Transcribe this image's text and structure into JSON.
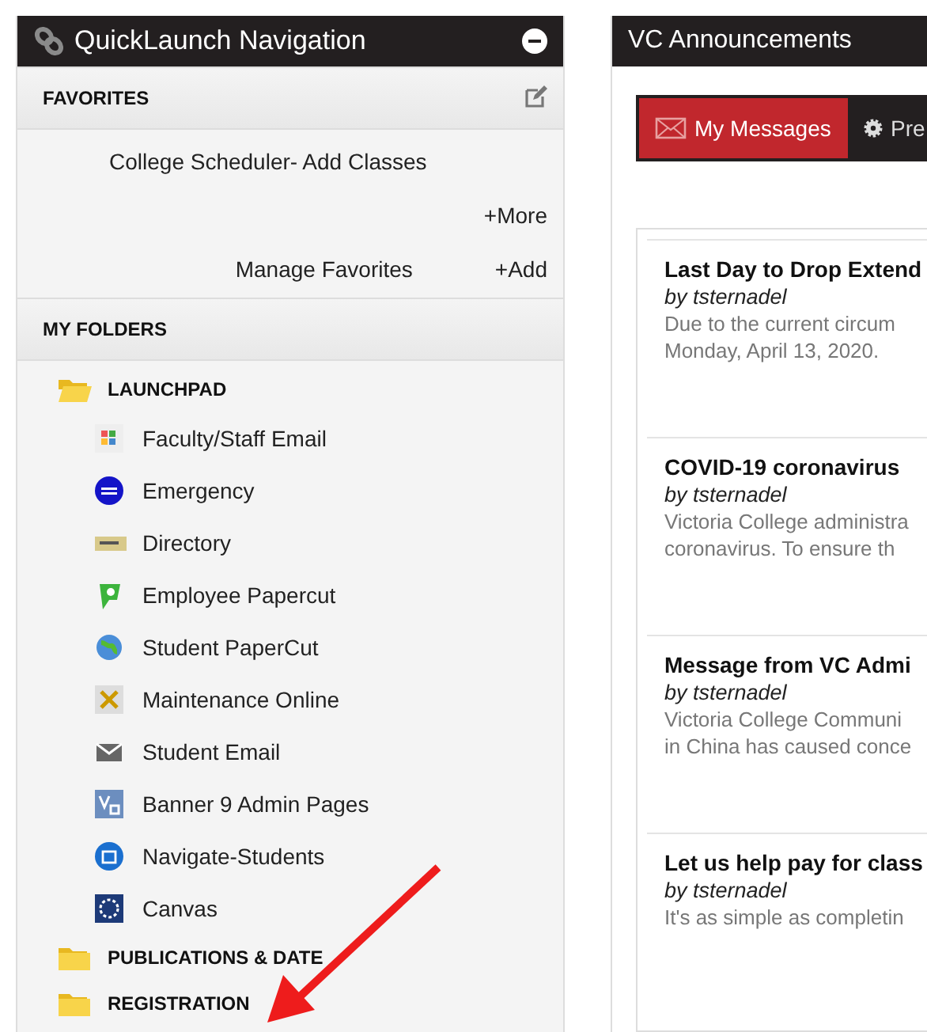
{
  "quicklaunch": {
    "title": "QuickLaunch Navigation",
    "collapsed": false,
    "favorites": {
      "heading": "FAVORITES",
      "items": [
        "College Scheduler- Add Classes"
      ],
      "more": "+More",
      "manage": "Manage Favorites",
      "add": "+Add"
    },
    "folders": {
      "heading": "MY FOLDERS",
      "items": [
        {
          "label": "LAUNCHPAD",
          "expanded": true,
          "children": [
            {
              "label": "Faculty/Staff Email",
              "kind": "mailapp"
            },
            {
              "label": "Emergency",
              "kind": "emergency"
            },
            {
              "label": "Directory",
              "kind": "directory"
            },
            {
              "label": "Employee Papercut",
              "kind": "papercut"
            },
            {
              "label": "Student PaperCut",
              "kind": "globe"
            },
            {
              "label": "Maintenance Online",
              "kind": "tools"
            },
            {
              "label": "Student Email",
              "kind": "envelope"
            },
            {
              "label": "Banner 9 Admin Pages",
              "kind": "vc"
            },
            {
              "label": "Navigate-Students",
              "kind": "navigate"
            },
            {
              "label": "Canvas",
              "kind": "canvas"
            }
          ]
        },
        {
          "label": "PUBLICATIONS & DATE",
          "expanded": false
        },
        {
          "label": "REGISTRATION",
          "expanded": false
        }
      ]
    }
  },
  "announcements": {
    "title": "VC Announcements",
    "tabs": [
      {
        "label": "My Messages",
        "selected": true,
        "kind": "mail"
      },
      {
        "label": "Pre",
        "selected": false,
        "kind": "gear"
      }
    ],
    "items": [
      {
        "title": "Last Day to Drop Extend",
        "author": "by tsternadel",
        "lines": [
          "Due to the current circum",
          "Monday, April 13, 2020."
        ]
      },
      {
        "title": "COVID-19 coronavirus",
        "author": "by tsternadel",
        "lines": [
          "Victoria College administra",
          "coronavirus.   To ensure th"
        ]
      },
      {
        "title": "Message from VC Admi",
        "author": "by tsternadel",
        "lines": [
          "Victoria College Communi",
          "in China has caused conce"
        ]
      },
      {
        "title": "Let us help pay for class",
        "author": "by tsternadel",
        "lines": [
          "It's as simple as completin"
        ]
      }
    ]
  }
}
